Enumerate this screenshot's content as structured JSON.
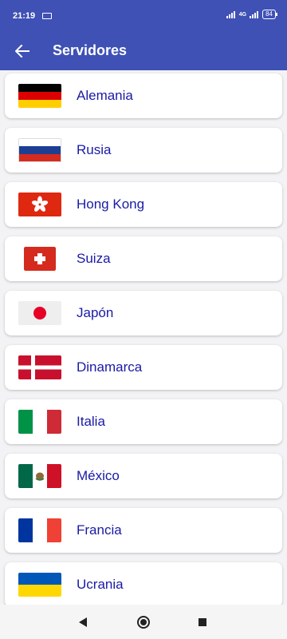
{
  "status": {
    "time": "21:19",
    "network": "4G",
    "battery": "84"
  },
  "header": {
    "title": "Servidores"
  },
  "servers": [
    {
      "name": "Alemania",
      "flag": "germany-flag-icon"
    },
    {
      "name": "Rusia",
      "flag": "russia-flag-icon"
    },
    {
      "name": "Hong Kong",
      "flag": "hong-kong-flag-icon"
    },
    {
      "name": "Suiza",
      "flag": "switzerland-flag-icon"
    },
    {
      "name": "Japón",
      "flag": "japan-flag-icon"
    },
    {
      "name": "Dinamarca",
      "flag": "denmark-flag-icon"
    },
    {
      "name": "Italia",
      "flag": "italy-flag-icon"
    },
    {
      "name": "México",
      "flag": "mexico-flag-icon"
    },
    {
      "name": "Francia",
      "flag": "france-flag-icon"
    },
    {
      "name": "Ucrania",
      "flag": "ukraine-flag-icon"
    }
  ],
  "colors": {
    "primary": "#3f51b5",
    "item_text": "#1a1aa6",
    "background": "#f3f3f5"
  }
}
